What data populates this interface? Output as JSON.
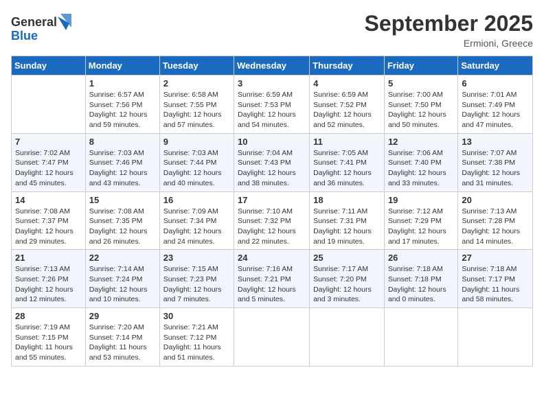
{
  "logo": {
    "general": "General",
    "blue": "Blue"
  },
  "title": "September 2025",
  "location": "Ermioni, Greece",
  "days_header": [
    "Sunday",
    "Monday",
    "Tuesday",
    "Wednesday",
    "Thursday",
    "Friday",
    "Saturday"
  ],
  "weeks": [
    [
      {
        "day": "",
        "info": ""
      },
      {
        "day": "1",
        "info": "Sunrise: 6:57 AM\nSunset: 7:56 PM\nDaylight: 12 hours\nand 59 minutes."
      },
      {
        "day": "2",
        "info": "Sunrise: 6:58 AM\nSunset: 7:55 PM\nDaylight: 12 hours\nand 57 minutes."
      },
      {
        "day": "3",
        "info": "Sunrise: 6:59 AM\nSunset: 7:53 PM\nDaylight: 12 hours\nand 54 minutes."
      },
      {
        "day": "4",
        "info": "Sunrise: 6:59 AM\nSunset: 7:52 PM\nDaylight: 12 hours\nand 52 minutes."
      },
      {
        "day": "5",
        "info": "Sunrise: 7:00 AM\nSunset: 7:50 PM\nDaylight: 12 hours\nand 50 minutes."
      },
      {
        "day": "6",
        "info": "Sunrise: 7:01 AM\nSunset: 7:49 PM\nDaylight: 12 hours\nand 47 minutes."
      }
    ],
    [
      {
        "day": "7",
        "info": "Sunrise: 7:02 AM\nSunset: 7:47 PM\nDaylight: 12 hours\nand 45 minutes."
      },
      {
        "day": "8",
        "info": "Sunrise: 7:03 AM\nSunset: 7:46 PM\nDaylight: 12 hours\nand 43 minutes."
      },
      {
        "day": "9",
        "info": "Sunrise: 7:03 AM\nSunset: 7:44 PM\nDaylight: 12 hours\nand 40 minutes."
      },
      {
        "day": "10",
        "info": "Sunrise: 7:04 AM\nSunset: 7:43 PM\nDaylight: 12 hours\nand 38 minutes."
      },
      {
        "day": "11",
        "info": "Sunrise: 7:05 AM\nSunset: 7:41 PM\nDaylight: 12 hours\nand 36 minutes."
      },
      {
        "day": "12",
        "info": "Sunrise: 7:06 AM\nSunset: 7:40 PM\nDaylight: 12 hours\nand 33 minutes."
      },
      {
        "day": "13",
        "info": "Sunrise: 7:07 AM\nSunset: 7:38 PM\nDaylight: 12 hours\nand 31 minutes."
      }
    ],
    [
      {
        "day": "14",
        "info": "Sunrise: 7:08 AM\nSunset: 7:37 PM\nDaylight: 12 hours\nand 29 minutes."
      },
      {
        "day": "15",
        "info": "Sunrise: 7:08 AM\nSunset: 7:35 PM\nDaylight: 12 hours\nand 26 minutes."
      },
      {
        "day": "16",
        "info": "Sunrise: 7:09 AM\nSunset: 7:34 PM\nDaylight: 12 hours\nand 24 minutes."
      },
      {
        "day": "17",
        "info": "Sunrise: 7:10 AM\nSunset: 7:32 PM\nDaylight: 12 hours\nand 22 minutes."
      },
      {
        "day": "18",
        "info": "Sunrise: 7:11 AM\nSunset: 7:31 PM\nDaylight: 12 hours\nand 19 minutes."
      },
      {
        "day": "19",
        "info": "Sunrise: 7:12 AM\nSunset: 7:29 PM\nDaylight: 12 hours\nand 17 minutes."
      },
      {
        "day": "20",
        "info": "Sunrise: 7:13 AM\nSunset: 7:28 PM\nDaylight: 12 hours\nand 14 minutes."
      }
    ],
    [
      {
        "day": "21",
        "info": "Sunrise: 7:13 AM\nSunset: 7:26 PM\nDaylight: 12 hours\nand 12 minutes."
      },
      {
        "day": "22",
        "info": "Sunrise: 7:14 AM\nSunset: 7:24 PM\nDaylight: 12 hours\nand 10 minutes."
      },
      {
        "day": "23",
        "info": "Sunrise: 7:15 AM\nSunset: 7:23 PM\nDaylight: 12 hours\nand 7 minutes."
      },
      {
        "day": "24",
        "info": "Sunrise: 7:16 AM\nSunset: 7:21 PM\nDaylight: 12 hours\nand 5 minutes."
      },
      {
        "day": "25",
        "info": "Sunrise: 7:17 AM\nSunset: 7:20 PM\nDaylight: 12 hours\nand 3 minutes."
      },
      {
        "day": "26",
        "info": "Sunrise: 7:18 AM\nSunset: 7:18 PM\nDaylight: 12 hours\nand 0 minutes."
      },
      {
        "day": "27",
        "info": "Sunrise: 7:18 AM\nSunset: 7:17 PM\nDaylight: 11 hours\nand 58 minutes."
      }
    ],
    [
      {
        "day": "28",
        "info": "Sunrise: 7:19 AM\nSunset: 7:15 PM\nDaylight: 11 hours\nand 55 minutes."
      },
      {
        "day": "29",
        "info": "Sunrise: 7:20 AM\nSunset: 7:14 PM\nDaylight: 11 hours\nand 53 minutes."
      },
      {
        "day": "30",
        "info": "Sunrise: 7:21 AM\nSunset: 7:12 PM\nDaylight: 11 hours\nand 51 minutes."
      },
      {
        "day": "",
        "info": ""
      },
      {
        "day": "",
        "info": ""
      },
      {
        "day": "",
        "info": ""
      },
      {
        "day": "",
        "info": ""
      }
    ]
  ]
}
